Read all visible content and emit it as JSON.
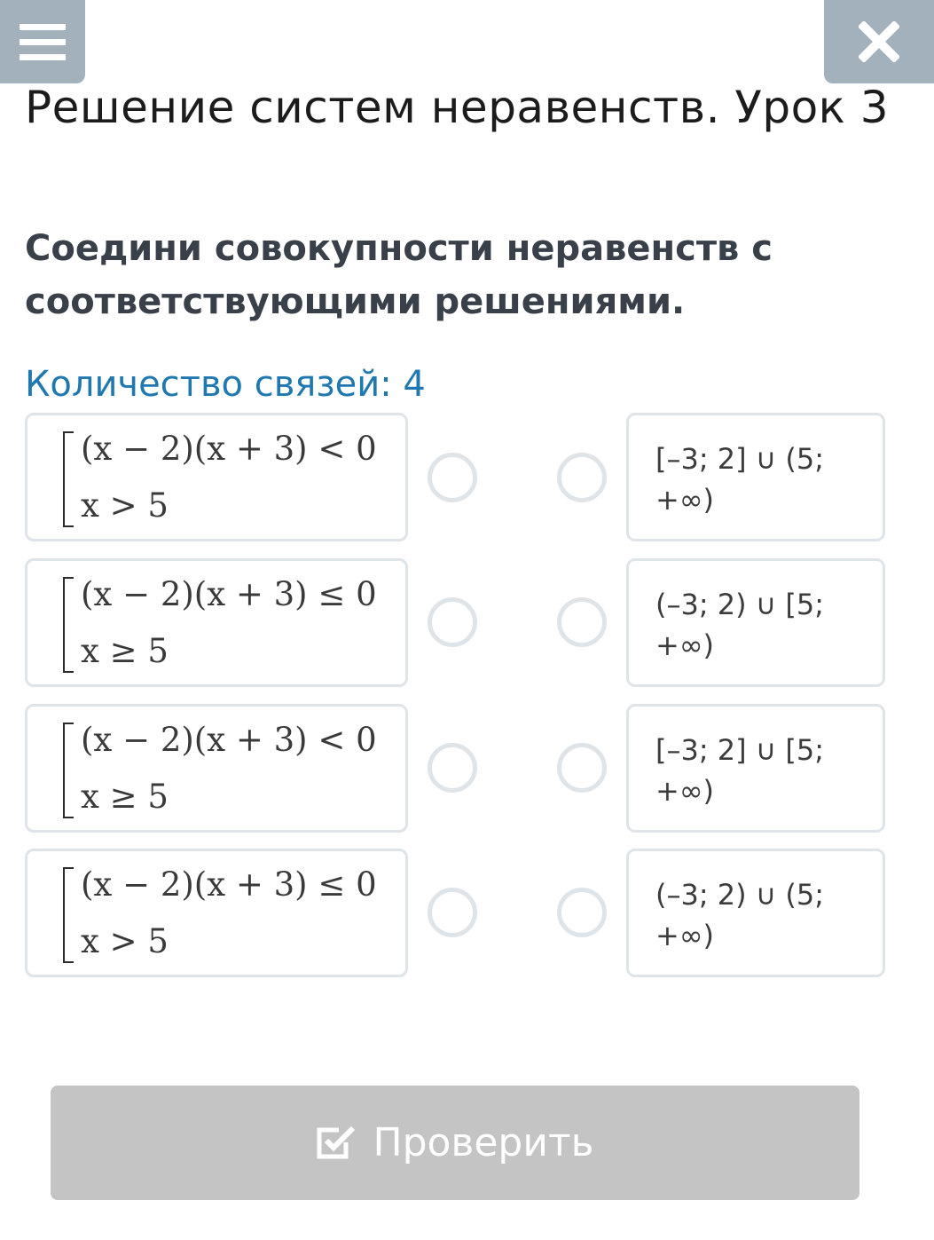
{
  "header": {
    "menu_icon": "hamburger-menu-icon",
    "close_icon": "close-x-icon",
    "title": "Решение систем неравенств. Урок 3"
  },
  "task": {
    "instruction": "Соедини совокупности неравенств с соответствующими решениями.",
    "links_count": "Количество связей: 4"
  },
  "left_items": [
    {
      "line1": "(x − 2)(x + 3) < 0",
      "line2": "x > 5"
    },
    {
      "line1": "(x − 2)(x + 3) ≤ 0",
      "line2": "x ≥ 5"
    },
    {
      "line1": "(x − 2)(x + 3) < 0",
      "line2": "x ≥ 5"
    },
    {
      "line1": "(x − 2)(x + 3) ≤ 0",
      "line2": "x > 5"
    }
  ],
  "right_items": [
    {
      "text": "[–3; 2] ∪ (5; +∞)"
    },
    {
      "text": "(–3; 2) ∪ [5; +∞)"
    },
    {
      "text": "[–3; 2] ∪ [5; +∞)"
    },
    {
      "text": "(–3; 2) ∪ (5; +∞)"
    }
  ],
  "footer": {
    "check_label": "Проверить",
    "check_icon": "checkbox-check-icon"
  },
  "colors": {
    "corner_buttons": "#a3b1bd",
    "links_count": "#1f78b0",
    "card_border": "#dfe4e9",
    "check_button": "#c4c4c4"
  }
}
